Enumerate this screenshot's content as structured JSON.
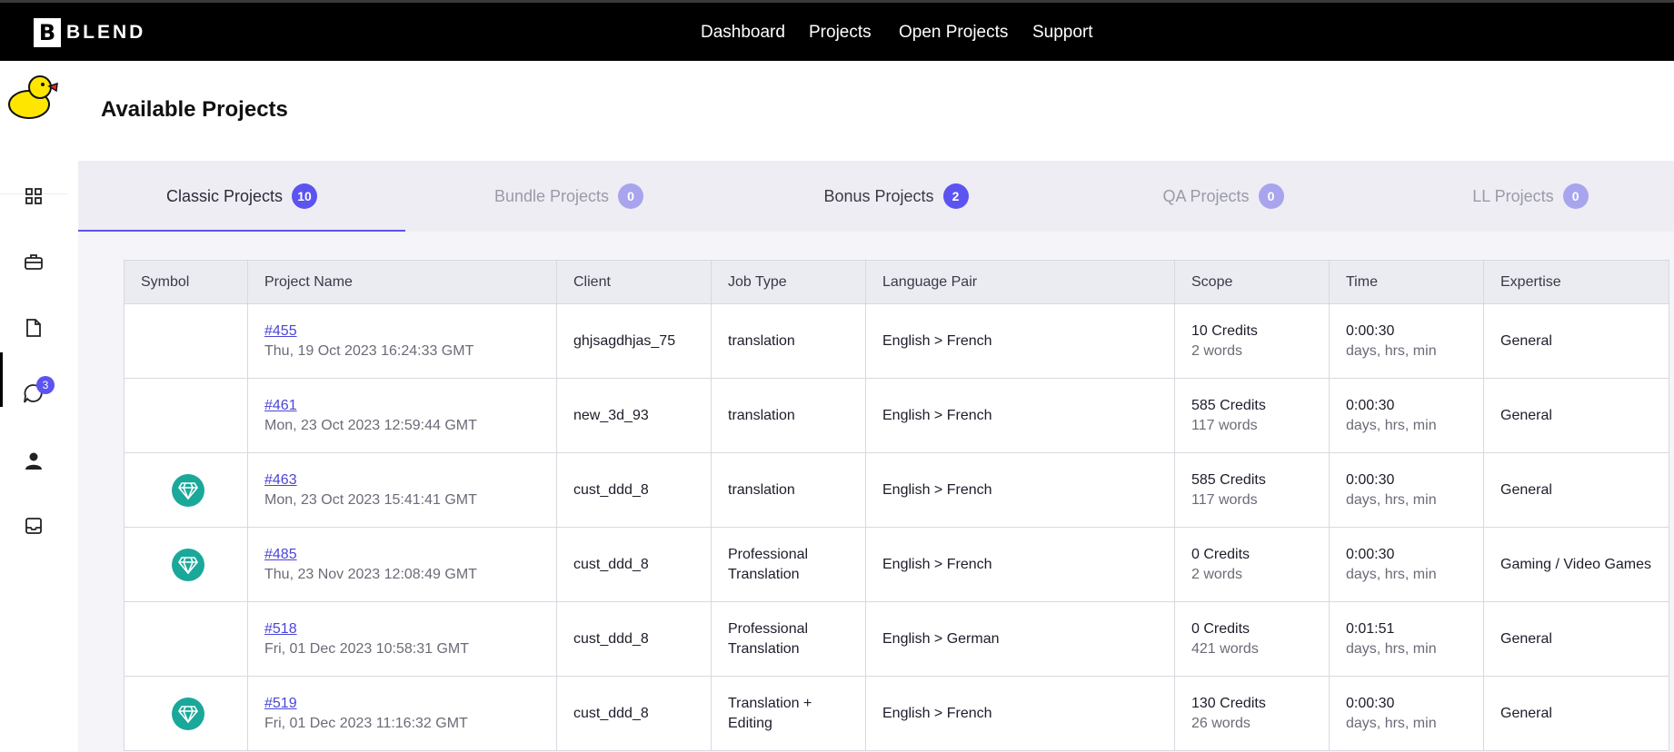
{
  "brand": {
    "logo_letter": "B",
    "logo_text": "BLEND"
  },
  "topnav": [
    {
      "label": "Dashboard"
    },
    {
      "label": "Projects"
    },
    {
      "label": "Open Projects"
    },
    {
      "label": "Support"
    }
  ],
  "sidebar": {
    "icons": [
      "grid-icon",
      "briefcase-icon",
      "document-icon",
      "chat-icon",
      "user-icon",
      "inbox-icon"
    ],
    "chat_badge": "3"
  },
  "page": {
    "title": "Available Projects"
  },
  "tabs": [
    {
      "label": "Classic Projects",
      "count": "10",
      "active": true
    },
    {
      "label": "Bundle Projects",
      "count": "0",
      "active": false
    },
    {
      "label": "Bonus Projects",
      "count": "2",
      "active": false
    },
    {
      "label": "QA Projects",
      "count": "0",
      "active": false
    },
    {
      "label": "LL Projects",
      "count": "0",
      "active": false
    }
  ],
  "colors": {
    "accent": "#5b54f0",
    "accent_muted": "#a8a4ee",
    "gem": "#1aa89a"
  },
  "table": {
    "headers": [
      "Symbol",
      "Project Name",
      "Client",
      "Job Type",
      "Language Pair",
      "Scope",
      "Time",
      "Expertise"
    ],
    "rows": [
      {
        "gem": false,
        "id": "#455",
        "date": "Thu, 19 Oct 2023 16:24:33 GMT",
        "client": "ghjsagdhjas_75",
        "job_type": "translation",
        "lang": "English > French",
        "credits": "10 Credits",
        "words": "2 words",
        "time": "0:00:30",
        "time_unit": "days, hrs, min",
        "expertise": "General"
      },
      {
        "gem": false,
        "id": "#461",
        "date": "Mon, 23 Oct 2023 12:59:44 GMT",
        "client": "new_3d_93",
        "job_type": "translation",
        "lang": "English > French",
        "credits": "585 Credits",
        "words": "117 words",
        "time": "0:00:30",
        "time_unit": "days, hrs, min",
        "expertise": "General"
      },
      {
        "gem": true,
        "id": "#463",
        "date": "Mon, 23 Oct 2023 15:41:41 GMT",
        "client": "cust_ddd_8",
        "job_type": "translation",
        "lang": "English > French",
        "credits": "585 Credits",
        "words": "117 words",
        "time": "0:00:30",
        "time_unit": "days, hrs, min",
        "expertise": "General"
      },
      {
        "gem": true,
        "id": "#485",
        "date": "Thu, 23 Nov 2023 12:08:49 GMT",
        "client": "cust_ddd_8",
        "job_type": "Professional Translation",
        "lang": "English > French",
        "credits": "0 Credits",
        "words": "2 words",
        "time": "0:00:30",
        "time_unit": "days, hrs, min",
        "expertise": "Gaming / Video Games"
      },
      {
        "gem": false,
        "id": "#518",
        "date": "Fri, 01 Dec 2023 10:58:31 GMT",
        "client": "cust_ddd_8",
        "job_type": "Professional Translation",
        "lang": "English > German",
        "credits": "0 Credits",
        "words": "421 words",
        "time": "0:01:51",
        "time_unit": "days, hrs, min",
        "expertise": "General"
      },
      {
        "gem": true,
        "id": "#519",
        "date": "Fri, 01 Dec 2023 11:16:32 GMT",
        "client": "cust_ddd_8",
        "job_type": "Translation + Editing",
        "lang": "English > French",
        "credits": "130 Credits",
        "words": "26 words",
        "time": "0:00:30",
        "time_unit": "days, hrs, min",
        "expertise": "General"
      }
    ]
  }
}
